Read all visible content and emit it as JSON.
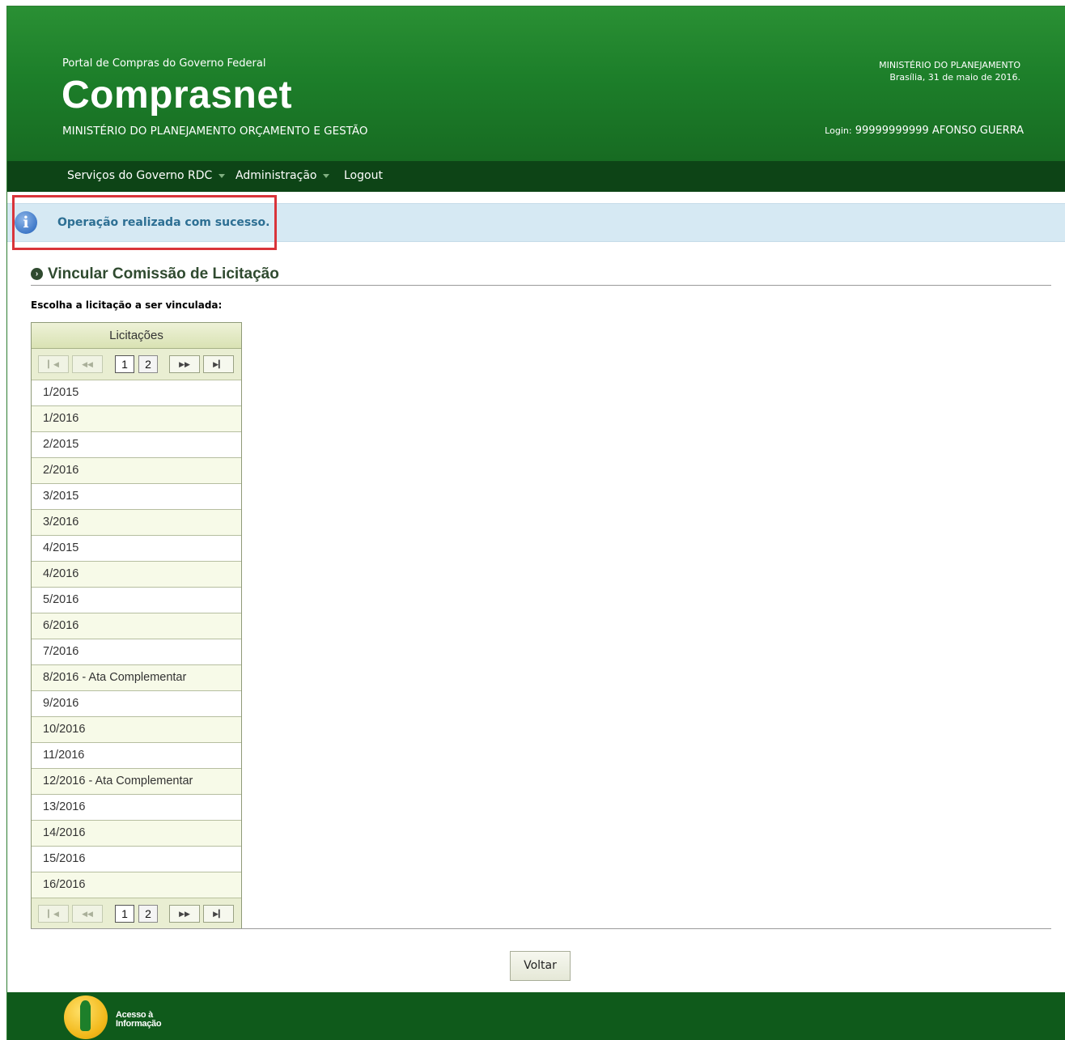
{
  "header": {
    "portal_subtitle": "Portal de Compras do Governo Federal",
    "title": "Comprasnet",
    "ministry": "MINISTÉRIO DO PLANEJAMENTO ORÇAMENTO E GESTÃO",
    "ministry_right": "MINISTÉRIO DO PLANEJAMENTO",
    "date": "Brasília, 31 de maio de 2016.",
    "login_label": "Login:",
    "login_value": "99999999999 AFONSO GUERRA"
  },
  "nav": {
    "items": [
      {
        "label": "Serviços do Governo RDC"
      },
      {
        "label": "Administração"
      },
      {
        "label": "Logout"
      }
    ]
  },
  "alert": {
    "icon": "info-icon",
    "message": "Operação realizada com sucesso."
  },
  "section": {
    "title": "Vincular Comissão de Licitação",
    "instruction": "Escolha a licitação a ser vinculada:"
  },
  "table": {
    "header": "Licitações",
    "pager": {
      "first": "⏮",
      "prev": "◀◀",
      "next": "▶▶",
      "last": "⏭",
      "pages": [
        "1",
        "2"
      ],
      "current_page": "1"
    },
    "rows": [
      "1/2015",
      "1/2016",
      "2/2015",
      "2/2016",
      "3/2015",
      "3/2016",
      "4/2015",
      "4/2016",
      "5/2016",
      "6/2016",
      "7/2016",
      "8/2016 - Ata Complementar",
      "9/2016",
      "10/2016",
      "11/2016",
      "12/2016 - Ata Complementar",
      "13/2016",
      "14/2016",
      "15/2016",
      "16/2016"
    ]
  },
  "buttons": {
    "back": "Voltar"
  },
  "footer": {
    "logo_line1": "Acesso à",
    "logo_line2": "Informação"
  },
  "colors": {
    "header_green": "#1d7f2a",
    "nav_green": "#0d4416",
    "alert_bg": "#d6e9f3",
    "alert_text": "#2d6f93",
    "highlight": "#d9343a"
  }
}
